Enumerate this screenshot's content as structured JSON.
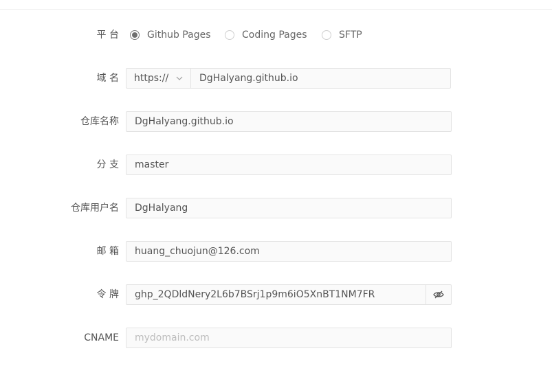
{
  "form": {
    "platform": {
      "label": "平 台",
      "options": [
        "Github Pages",
        "Coding Pages",
        "SFTP"
      ],
      "selected": "Github Pages"
    },
    "domain": {
      "label": "域 名",
      "protocol": "https://",
      "value": "DgHalyang.github.io"
    },
    "repo_name": {
      "label": "仓库名称",
      "value": "DgHalyang.github.io"
    },
    "branch": {
      "label": "分 支",
      "value": "master"
    },
    "repo_user": {
      "label": "仓库用户名",
      "value": "DgHalyang"
    },
    "email": {
      "label": "邮 箱",
      "value": "huang_chuojun@126.com"
    },
    "token": {
      "label": "令 牌",
      "value": "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",
      "icon": "eye-off-icon"
    },
    "cname": {
      "label": "CNAME",
      "value": "",
      "placeholder": "mydomain.com"
    }
  }
}
